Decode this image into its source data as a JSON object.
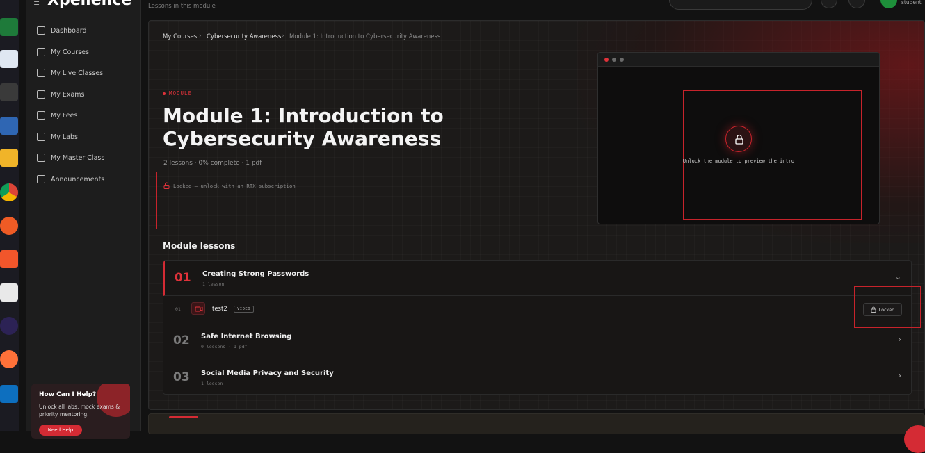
{
  "app": {
    "logo_text": "Xpellence",
    "header_subtitle": "Lessons in this module",
    "user_role": "student"
  },
  "sidebar": {
    "items": [
      {
        "label": "Dashboard",
        "icon": "grid-icon"
      },
      {
        "label": "My Courses",
        "icon": "book-icon"
      },
      {
        "label": "My Live Classes",
        "icon": "video-icon"
      },
      {
        "label": "My Exams",
        "icon": "clipboard-icon"
      },
      {
        "label": "My Fees",
        "icon": "card-icon"
      },
      {
        "label": "My Labs",
        "icon": "flask-icon"
      },
      {
        "label": "My Master Class",
        "icon": "monitor-icon"
      },
      {
        "label": "Announcements",
        "icon": "megaphone-icon"
      }
    ],
    "help": {
      "title": "How Can I Help?",
      "text": "Unlock all labs, mock exams & priority mentoring.",
      "button": "Need Help"
    }
  },
  "breadcrumb": [
    "My Courses",
    "Cybersecurity Awareness",
    "Module 1: Introduction to Cybersecurity Awareness"
  ],
  "module": {
    "tag": "MODULE",
    "title": "Module 1: Introduction to Cybersecurity Awareness",
    "meta": "2 lessons · 0% complete · 1 pdf",
    "locked_note": "Locked — unlock with an RTX subscription"
  },
  "preview": {
    "text": "Unlock the module to preview the intro"
  },
  "lessons_heading": "Module lessons",
  "lessons": [
    {
      "num": "01",
      "title": "Creating Strong Passwords",
      "sub": "1 lesson",
      "expanded": true,
      "items": [
        {
          "num": "01",
          "title": "test2",
          "type": "VIDEO",
          "status": "Locked"
        }
      ]
    },
    {
      "num": "02",
      "title": "Safe Internet Browsing",
      "sub": "0 lessons · 1 pdf",
      "expanded": false
    },
    {
      "num": "03",
      "title": "Social Media Privacy and Security",
      "sub": "1 lesson",
      "expanded": false
    }
  ],
  "colors": {
    "accent": "#d42b34",
    "panel": "#1c1a19",
    "sidebar": "#1d1d1d"
  }
}
